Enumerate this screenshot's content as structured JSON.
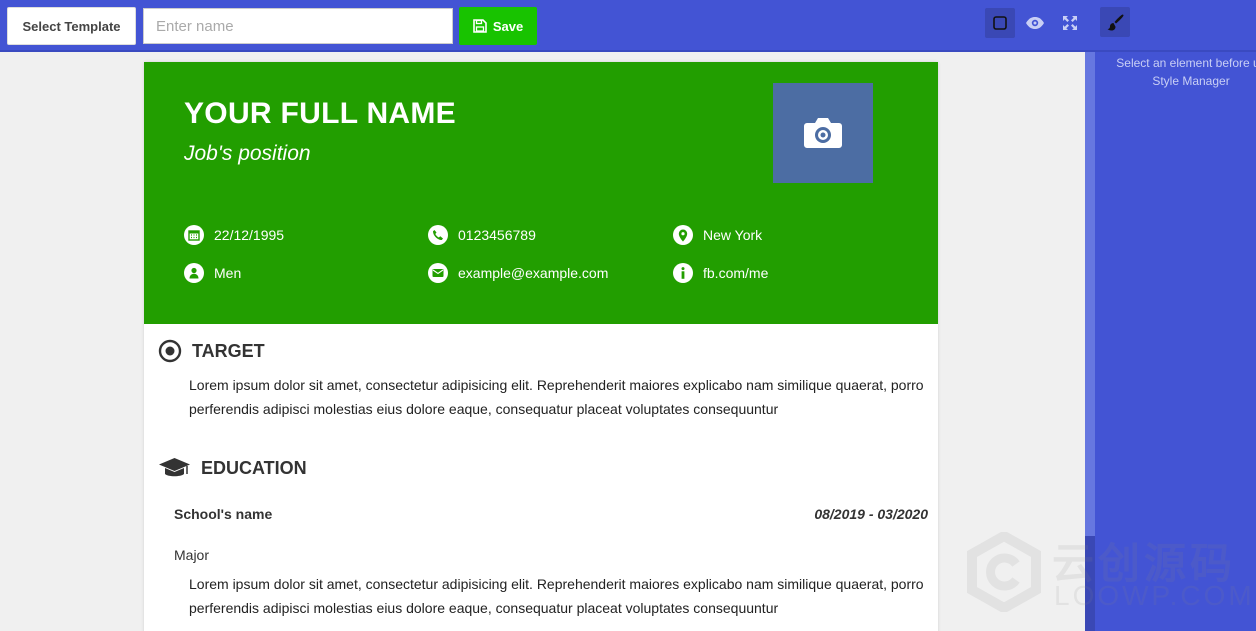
{
  "toolbar": {
    "select_template_label": "Select Template",
    "name_placeholder": "Enter name",
    "name_value": "",
    "save_label": "Save",
    "icons": [
      "square-outline-icon",
      "eye-icon",
      "fullscreen-icon"
    ]
  },
  "right_panel": {
    "icon": "paint-brush-icon",
    "message_line1": "Select an element before us",
    "message_line2": "Style Manager"
  },
  "resume": {
    "full_name": "YOUR FULL NAME",
    "job_position": "Job's position",
    "photo_icon": "camera-icon",
    "info": {
      "birthday": "22/12/1995",
      "phone": "0123456789",
      "city": "New York",
      "gender": "Men",
      "email": "example@example.com",
      "social": "fb.com/me"
    },
    "target": {
      "title": "TARGET",
      "text": "Lorem ipsum dolor sit amet, consectetur adipisicing elit. Reprehenderit maiores explicabo nam similique quaerat, porro perferendis adipisci molestias eius dolore eaque, consequatur placeat voluptates consequuntur"
    },
    "education": {
      "title": "EDUCATION",
      "school": "School's name",
      "dates": "08/2019 - 03/2020",
      "major": "Major",
      "text": "Lorem ipsum dolor sit amet, consectetur adipisicing elit. Reprehenderit maiores explicabo nam similique quaerat, porro perferendis adipisci molestias eius dolore eaque, consequatur placeat voluptates consequuntur"
    }
  },
  "colors": {
    "toolbar": "#4354d4",
    "header_green": "#229e00",
    "save_green": "#18c300",
    "photo_bg": "#4c6da3"
  },
  "watermark": {
    "line1": "云创源码",
    "line2": "LOOWP.COM"
  }
}
